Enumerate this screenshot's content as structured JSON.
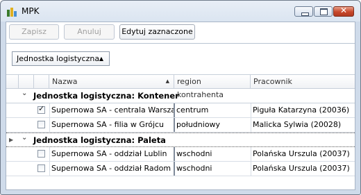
{
  "window": {
    "title": "MPK"
  },
  "toolbar": {
    "save_label": "Zapisz",
    "cancel_label": "Anuluj",
    "edit_label": "Edytuj zaznaczone"
  },
  "groupby": {
    "label": "Jednostka logistyczna"
  },
  "columns": {
    "name": "Nazwa",
    "region": "region kontrahenta",
    "employee": "Pracownik"
  },
  "groups": [
    {
      "label": "Jednostka logistyczna: Kontener",
      "rows": [
        {
          "checked": true,
          "name": "Supernowa SA - centrala Warszawa",
          "region": "centrum",
          "employee": "Piguła Katarzyna (20036)"
        },
        {
          "checked": false,
          "name": "Supernowa SA - filia w Grójcu",
          "region": "południowy",
          "employee": "Malicka Sylwia (20028)"
        }
      ]
    },
    {
      "label": "Jednostka logistyczna: Paleta",
      "rows": [
        {
          "checked": false,
          "name": "Supernowa SA - oddział Lublin",
          "region": "wschodni",
          "employee": "Polańska Urszula (20037)"
        },
        {
          "checked": false,
          "name": "Supernowa SA - oddział Radom",
          "region": "wschodni",
          "employee": "Polańska Urszula (20037)"
        }
      ]
    }
  ],
  "icons": {
    "minimize": "minimize-icon",
    "maximize": "maximize-icon",
    "close": "close-icon",
    "checkmark": "✓"
  }
}
